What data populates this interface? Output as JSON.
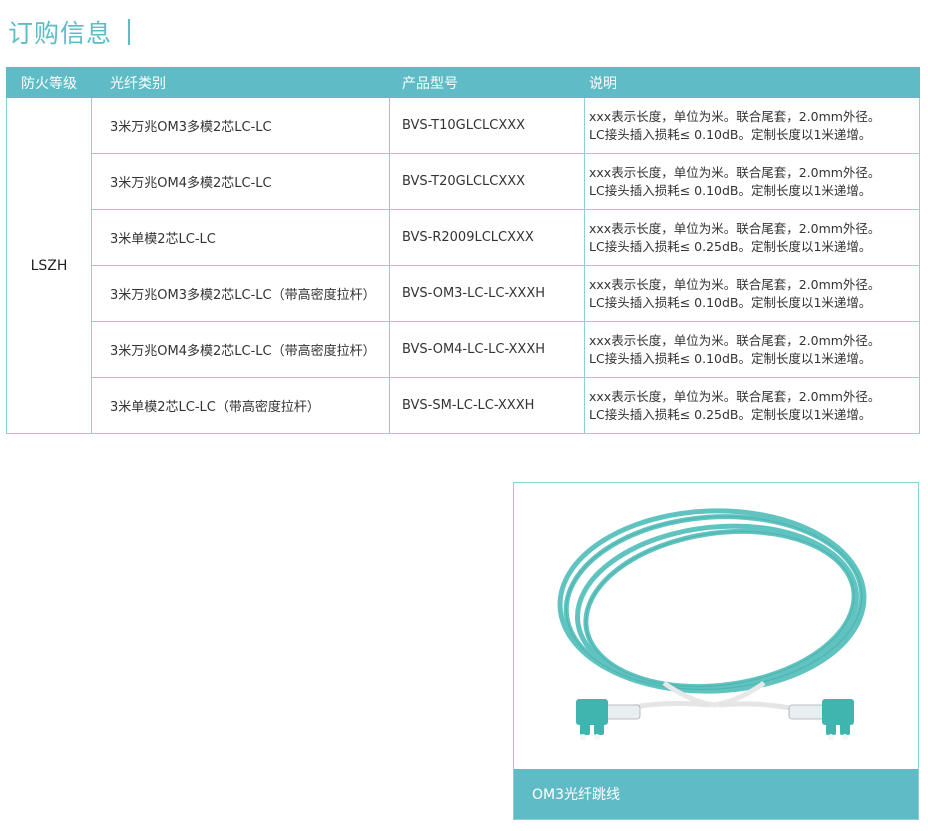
{
  "page_title": "订购信息",
  "table": {
    "headers": [
      "防火等级",
      "光纤类别",
      "产品型号",
      "说明"
    ],
    "fire_rating": "LSZH",
    "rows": [
      {
        "type": "3米万兆OM3多模2芯LC-LC",
        "model": "BVS-T10GLCLCXXX",
        "desc1": "xxx表示长度，单位为米。联合尾套，2.0mm外径。",
        "desc2": "LC接头插入损耗≤ 0.10dB。定制长度以1米递增。"
      },
      {
        "type": "3米万兆OM4多模2芯LC-LC",
        "model": "BVS-T20GLCLCXXX",
        "desc1": "xxx表示长度，单位为米。联合尾套，2.0mm外径。",
        "desc2": "LC接头插入损耗≤ 0.10dB。定制长度以1米递增。"
      },
      {
        "type": "3米单模2芯LC-LC",
        "model": "BVS-R2009LCLCXXX",
        "desc1": "xxx表示长度，单位为米。联合尾套，2.0mm外径。",
        "desc2": "LC接头插入损耗≤ 0.25dB。定制长度以1米递增。"
      },
      {
        "type": "3米万兆OM3多模2芯LC-LC（带高密度拉杆）",
        "model": "BVS-OM3-LC-LC-XXXH",
        "desc1": "xxx表示长度，单位为米。联合尾套，2.0mm外径。",
        "desc2": "LC接头插入损耗≤ 0.10dB。定制长度以1米递增。"
      },
      {
        "type": "3米万兆OM4多模2芯LC-LC（带高密度拉杆）",
        "model": "BVS-OM4-LC-LC-XXXH",
        "desc1": "xxx表示长度，单位为米。联合尾套，2.0mm外径。",
        "desc2": "LC接头插入损耗≤ 0.10dB。定制长度以1米递增。"
      },
      {
        "type": "3米单模2芯LC-LC（带高密度拉杆）",
        "model": "BVS-SM-LC-LC-XXXH",
        "desc1": "xxx表示长度，单位为米。联合尾套，2.0mm外径。",
        "desc2": "LC接头插入损耗≤ 0.25dB。定制长度以1米递增。"
      }
    ]
  },
  "product_photo": {
    "caption": "OM3光纤跳线",
    "cable_color": "#5fc4c0",
    "connector_color": "#3fb5b0"
  },
  "colors": {
    "accent": "#5fbcc7",
    "border": "#8fd0d8"
  }
}
